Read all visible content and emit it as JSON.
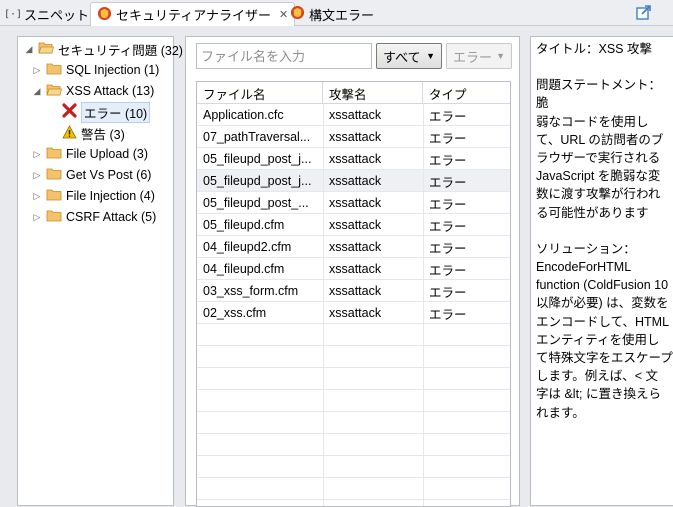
{
  "tabs": [
    {
      "label": "スニペット",
      "icon": "snippet-icon"
    },
    {
      "label": "セキュリティアナライザー",
      "icon": "security-analyzer-icon",
      "active": true
    },
    {
      "label": "構文エラー",
      "icon": "syntax-error-icon"
    }
  ],
  "tree": {
    "root": "セキュリティ問題 (32)",
    "items": [
      {
        "label": "SQL Injection (1)"
      },
      {
        "label": "XSS Attack (13)",
        "expanded": true,
        "children": [
          {
            "label": "エラー (10)",
            "icon": "error-icon",
            "selected": true
          },
          {
            "label": "警告 (3)",
            "icon": "warning-icon"
          }
        ]
      },
      {
        "label": "File Upload (3)"
      },
      {
        "label": "Get Vs Post (6)"
      },
      {
        "label": "File Injection (4)"
      },
      {
        "label": "CSRF Attack (5)"
      }
    ]
  },
  "filter": {
    "search_placeholder": "ファイル名を入力",
    "scope_value": "すべて",
    "severity_value": "エラー"
  },
  "table": {
    "headers": [
      "ファイル名",
      "攻撃名",
      "タイプ"
    ],
    "rows": [
      [
        "Application.cfc",
        "xssattack",
        "エラー"
      ],
      [
        "07_pathTraversal...",
        "xssattack",
        "エラー"
      ],
      [
        "05_fileupd_post_j...",
        "xssattack",
        "エラー"
      ],
      [
        "05_fileupd_post_j...",
        "xssattack",
        "エラー"
      ],
      [
        "05_fileupd_post_...",
        "xssattack",
        "エラー"
      ],
      [
        "05_fileupd.cfm",
        "xssattack",
        "エラー"
      ],
      [
        "04_fileupd2.cfm",
        "xssattack",
        "エラー"
      ],
      [
        "04_fileupd.cfm",
        "xssattack",
        "エラー"
      ],
      [
        "03_xss_form.cfm",
        "xssattack",
        "エラー"
      ],
      [
        "02_xss.cfm",
        "xssattack",
        "エラー"
      ]
    ],
    "selected_row": 3
  },
  "detail": {
    "title": "タイトル：XSS 攻撃",
    "statement": "問題ステートメント：脆\n弱なコードを使用し\nて、URL の訪問者のブ\nラウザーで実行される\nJavaScript を脆弱な変\n数に渡す攻撃が行われ\nる可能性があります",
    "solution": "ソリューション：\nEncodeForHTML\nfunction (ColdFusion 10\n以降が必要) は、変数を\nエンコードして、HTML\nエンティティを使用し\nて特殊文字をエスケープ\nします。例えば、< 文\n字は &lt; に置き換えら\nれます。"
  },
  "colors": {
    "error_red": "#cc1b1b",
    "warning_yellow": "#f2c200",
    "folder_orange": "#e8a33a"
  }
}
